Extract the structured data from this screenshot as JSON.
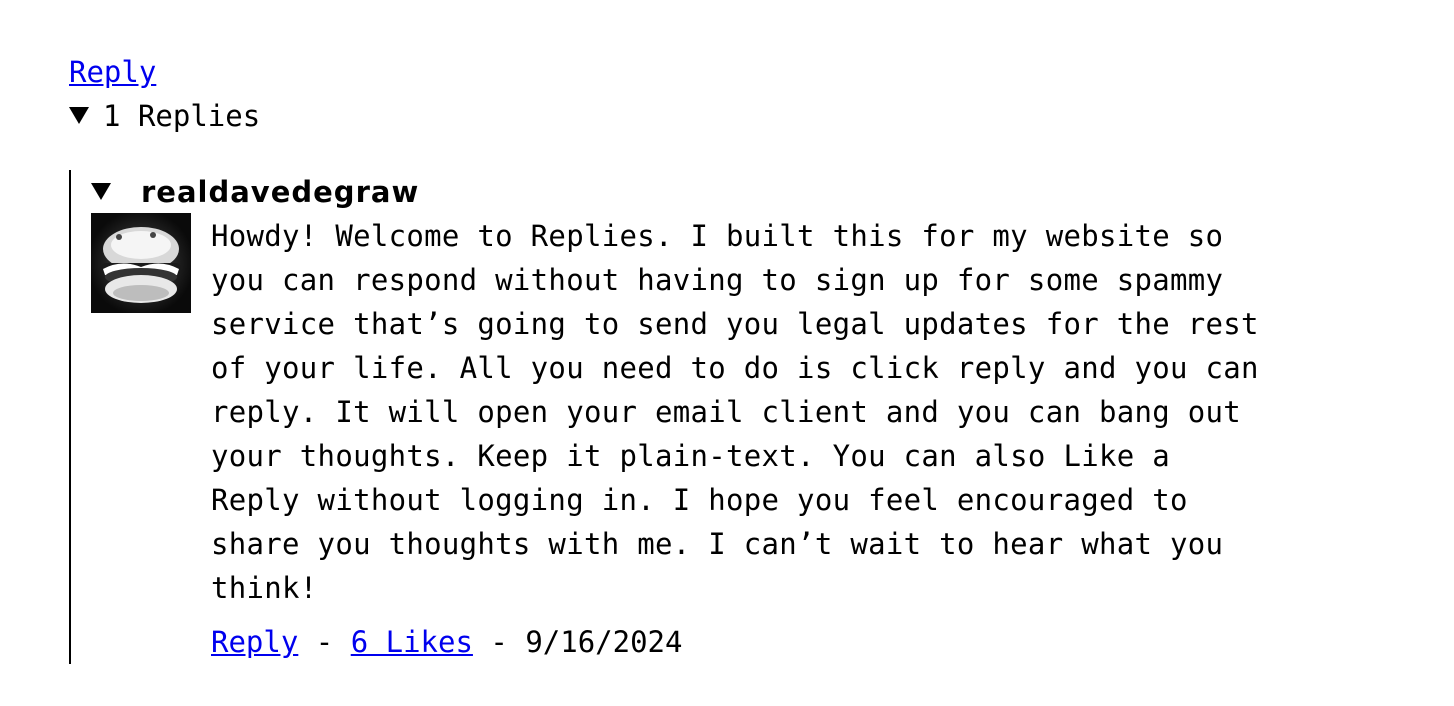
{
  "top_reply_label": "Reply",
  "replies_summary": {
    "count": "1",
    "label": "Replies"
  },
  "comment": {
    "author": "realdavedegraw",
    "avatar_icon": "burger-avatar-icon",
    "body": "Howdy! Welcome to Replies. I built this for my website so\nyou can respond without having to sign up for some spammy\nservice that’s going to send you legal updates for the rest\nof your life. All you need to do is click reply and you can\nreply. It will open your email client and you can bang out\nyour thoughts. Keep it plain-text. You can also Like a\nReply without logging in. I hope you feel encouraged to\nshare you thoughts with me. I can’t wait to hear what you\nthink!",
    "reply_label": "Reply",
    "separator": "-",
    "likes_label": "6 Likes",
    "date": "9/16/2024"
  },
  "colors": {
    "link": "#0000ee",
    "text": "#000000",
    "background": "#ffffff"
  }
}
